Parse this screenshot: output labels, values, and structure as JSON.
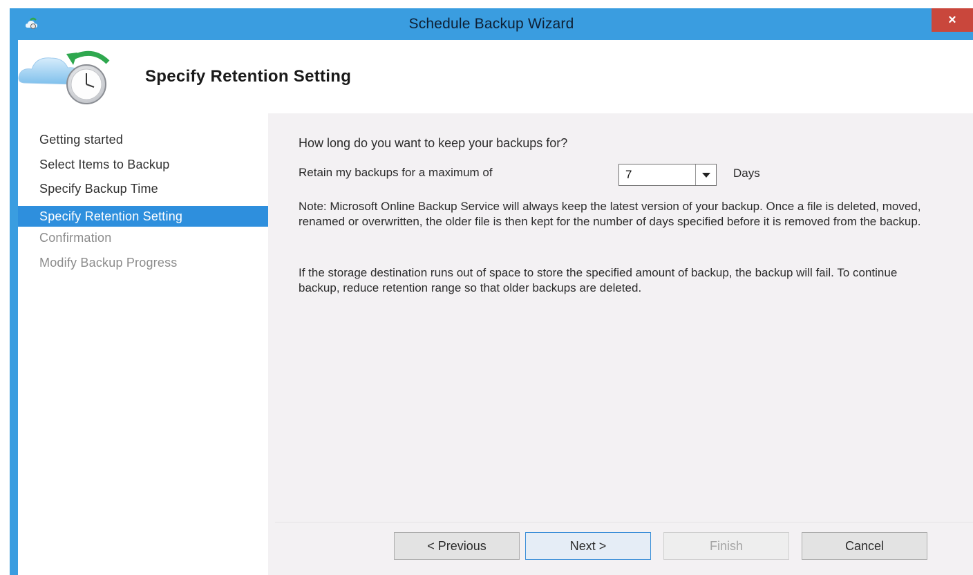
{
  "window": {
    "title": "Schedule Backup Wizard",
    "close_label": "×"
  },
  "header": {
    "title": "Specify Retention Setting",
    "icon": "cloud-clock-icon"
  },
  "sidebar": {
    "items": [
      {
        "label": "Getting started",
        "state": "normal"
      },
      {
        "label": "Select Items to Backup",
        "state": "normal"
      },
      {
        "label": "Specify Backup Time",
        "state": "normal"
      },
      {
        "label": "Specify Retention Setting",
        "state": "active"
      },
      {
        "label": "Confirmation",
        "state": "disabled"
      },
      {
        "label": "Modify Backup Progress",
        "state": "disabled"
      }
    ]
  },
  "main": {
    "question": "How long do you want to keep your backups for?",
    "retain_label": "Retain my backups for a maximum of",
    "retention_value": "7",
    "days_label": "Days",
    "note": "Note: Microsoft Online Backup Service will always keep the latest version of your backup. Once a file is deleted, moved, renamed or overwritten, the older file is then kept for the number of days specified before it is removed from the backup.",
    "warning": "If the storage destination runs out of space to store the specified amount of backup, the backup will fail. To continue backup, reduce retention range so that older backups are deleted."
  },
  "footer": {
    "previous_label": "< Previous",
    "next_label": "Next >",
    "finish_label": "Finish",
    "cancel_label": "Cancel"
  },
  "colors": {
    "titlebar": "#3a9de0",
    "active_step": "#2e8fdd",
    "close_button": "#c9473c"
  }
}
